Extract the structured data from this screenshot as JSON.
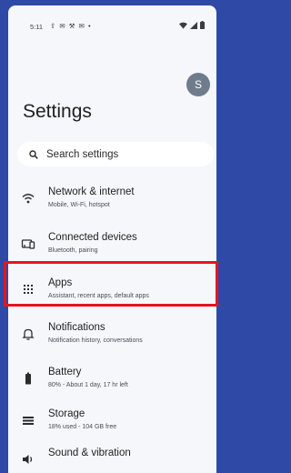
{
  "status_bar": {
    "time": "5:11",
    "notification_icons": [
      "upload-icon",
      "gmail-icon",
      "wrench-icon",
      "gmail-icon",
      "dot-icon"
    ],
    "system_icons": [
      "wifi-icon",
      "signal-icon",
      "battery-icon"
    ]
  },
  "header": {
    "title": "Settings",
    "avatar_initial": "S"
  },
  "search": {
    "placeholder": "Search settings"
  },
  "items": [
    {
      "icon": "wifi-icon",
      "label": "Network & internet",
      "sub": "Mobile, Wi-Fi, hotspot"
    },
    {
      "icon": "devices-icon",
      "label": "Connected devices",
      "sub": "Bluetooth, pairing"
    },
    {
      "icon": "apps-grid-icon",
      "label": "Apps",
      "sub": "Assistant, recent apps, default apps"
    },
    {
      "icon": "bell-icon",
      "label": "Notifications",
      "sub": "Notification history, conversations"
    },
    {
      "icon": "battery-icon",
      "label": "Battery",
      "sub": "80% - About 1 day, 17 hr left"
    },
    {
      "icon": "storage-icon",
      "label": "Storage",
      "sub": "18% used - 104 GB free"
    },
    {
      "icon": "speaker-icon",
      "label": "Sound & vibration",
      "sub": ""
    }
  ],
  "colors": {
    "frame": "#2f49a6",
    "background": "#f5f7fb",
    "highlight": "#e8141c"
  }
}
